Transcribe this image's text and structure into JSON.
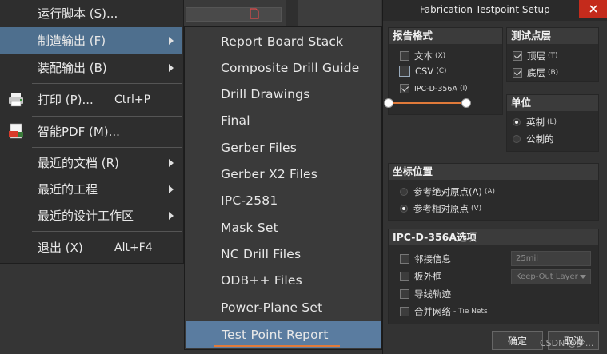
{
  "main_menu": {
    "items": [
      {
        "label": "运行脚本 (S)...",
        "shortcut": ""
      },
      {
        "label": "制造输出 (F)",
        "shortcut": ""
      },
      {
        "label": "装配输出 (B)",
        "shortcut": ""
      },
      {
        "label": "打印 (P)...",
        "shortcut": "Ctrl+P"
      },
      {
        "label": "智能PDF (M)...",
        "shortcut": ""
      },
      {
        "label": "最近的文档 (R)",
        "shortcut": ""
      },
      {
        "label": "最近的工程",
        "shortcut": ""
      },
      {
        "label": "最近的设计工作区",
        "shortcut": ""
      },
      {
        "label": "退出 (X)",
        "shortcut": "Alt+F4"
      }
    ]
  },
  "submenu": {
    "items": [
      "Report Board Stack",
      "Composite Drill Guide",
      "Drill Drawings",
      "Final",
      "Gerber Files",
      "Gerber X2 Files",
      "IPC-2581",
      "Mask Set",
      "NC Drill Files",
      "ODB++ Files",
      "Power-Plane Set",
      "Test Point Report"
    ]
  },
  "dialog": {
    "title": "Fabrication Testpoint Setup",
    "report_format": {
      "header": "报告格式",
      "text_label": "文本",
      "text_key": "(X)",
      "csv_label": "CSV",
      "csv_key": "(C)",
      "ipc_label": "IPC-D-356A",
      "ipc_key": "(I)",
      "text_checked": false,
      "csv_checked": false,
      "ipc_checked": true
    },
    "layers": {
      "header": "测试点层",
      "top_label": "顶层",
      "top_key": "(T)",
      "bottom_label": "底层",
      "bottom_key": "(B)",
      "top_checked": true,
      "bottom_checked": true
    },
    "units": {
      "header": "单位",
      "imperial_label": "英制",
      "imperial_key": "(L)",
      "metric_label": "公制的",
      "selected": "imperial"
    },
    "coords": {
      "header": "坐标位置",
      "absolute_label": "参考绝对原点(A)",
      "absolute_key": "(A)",
      "relative_label": "参考相对原点",
      "relative_key": "(V)",
      "selected": "relative"
    },
    "ipc_options": {
      "header": "IPC-D-356A选项",
      "adjacency_label": "邻接信息",
      "outline_label": "板外框",
      "traces_label": "导线轨迹",
      "merge_label": "合并网络",
      "merge_suffix": "- Tie Nets",
      "adjacency_value": "25mil",
      "outline_layer": "Keep-Out Layer"
    },
    "ok_label": "确定",
    "cancel_label": "取消"
  },
  "watermark": "CSDN @梦...",
  "colors": {
    "menu_bg": "#2e2e2e",
    "submenu_bg": "#3a3a3a",
    "highlight": "#4e6f8e",
    "accent_orange": "#e07a3a",
    "close_red": "#c42b1c"
  }
}
